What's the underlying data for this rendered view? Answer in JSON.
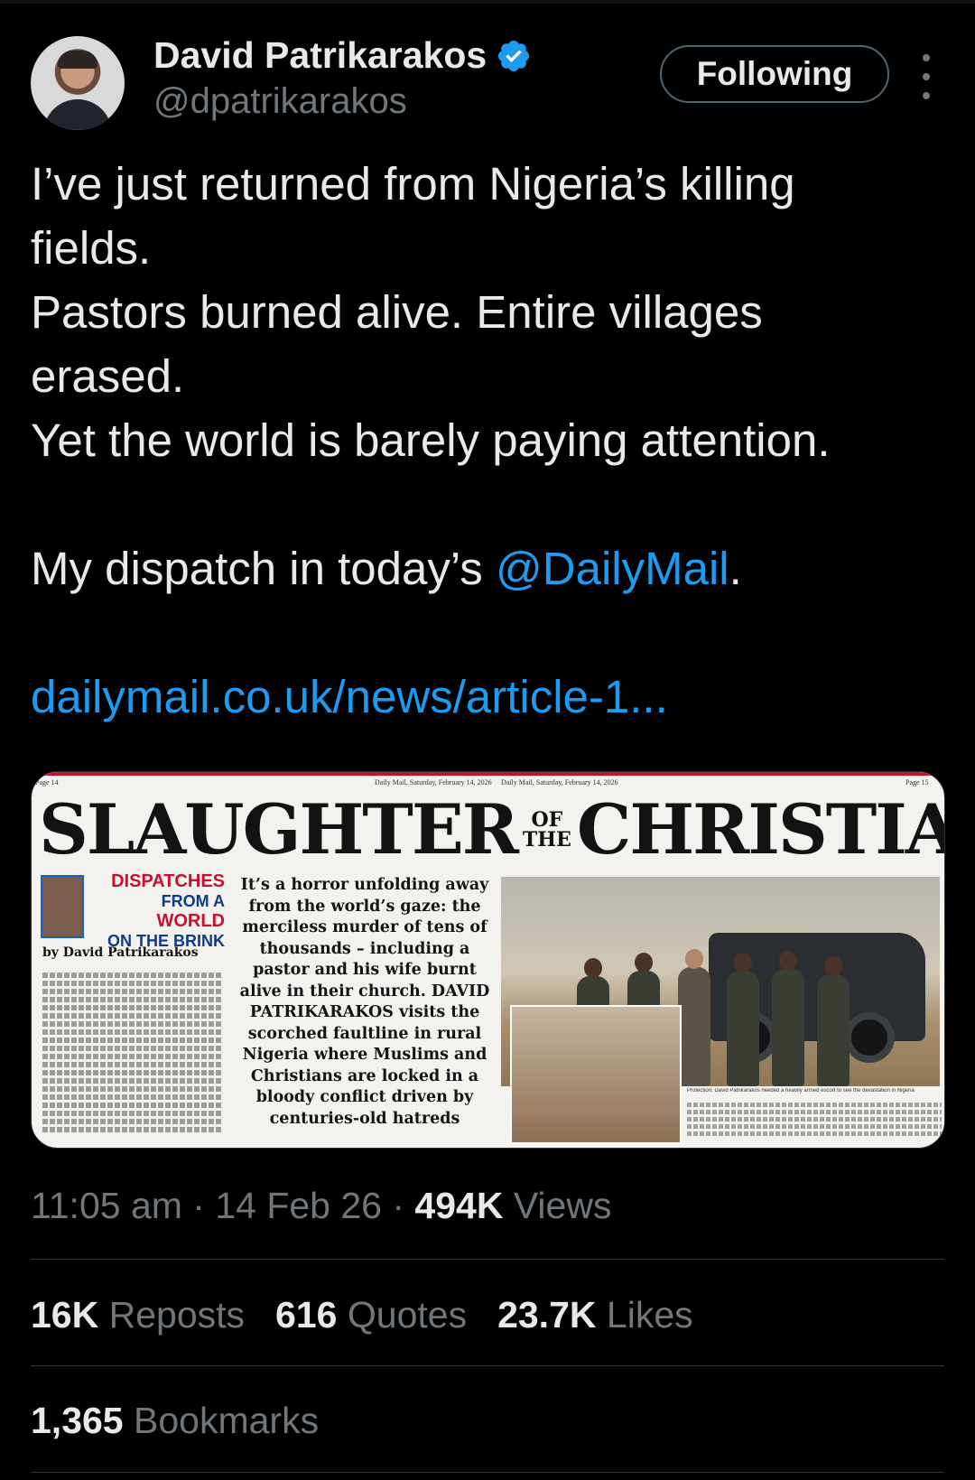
{
  "author": {
    "name": "David Patrikarakos",
    "handle": "@dpatrikarakos",
    "verified": true
  },
  "follow_button": {
    "label": "Following"
  },
  "tweet": {
    "line1": "I’ve just returned from Nigeria’s killing",
    "line2": "fields.",
    "line3": "Pastors burned alive. Entire villages",
    "line4": "erased.",
    "line5": "Yet the world is barely paying attention.",
    "dispatch_prefix": "My dispatch in today’s ",
    "mention": "@DailyMail",
    "dispatch_suffix": ".",
    "link": "dailymail.co.uk/news/article-1..."
  },
  "media": {
    "page_left": "Page 14",
    "page_right": "Page 15",
    "dateline_left": "Daily Mail, Saturday, February 14, 2026",
    "dateline_right": "Daily Mail, Saturday, February 14, 2026",
    "headline_left": "SLAUGHTER",
    "headline_of": "OF",
    "headline_the": "THE",
    "headline_right": "CHRISTIANS",
    "label_dispatches": "DISPATCHES",
    "label_from_a": "FROM A",
    "label_world": "WORLD",
    "label_brink": "ON THE BRINK",
    "byline": "by David Patrikarakos",
    "standfirst": "It’s a horror unfolding away from the world’s gaze: the merciless murder of tens of thousands – including a pastor and his wife burnt alive in their church. DAVID PATRIKARAKOS visits the scorched faultline in rural Nigeria where Muslims and Christians are locked in a bloody conflict driven by centuries-old hatreds",
    "caption": "Protection: David Patrikarakos needed a heavily armed escort to see the devastation in Nigeria"
  },
  "meta": {
    "time": "11:05 am",
    "sep1": " · ",
    "date": "14 Feb 26",
    "sep2": " · ",
    "views_count": "494K",
    "views_label": " Views"
  },
  "stats": {
    "reposts_count": "16K",
    "reposts_label": "Reposts",
    "quotes_count": "616",
    "quotes_label": "Quotes",
    "likes_count": "23.7K",
    "likes_label": "Likes",
    "bookmarks_count": "1,365",
    "bookmarks_label": "Bookmarks"
  },
  "colors": {
    "background": "#000000",
    "text": "#e7e9ea",
    "secondary": "#71767b",
    "accent": "#1d9bf0",
    "divider": "#2f3336"
  }
}
